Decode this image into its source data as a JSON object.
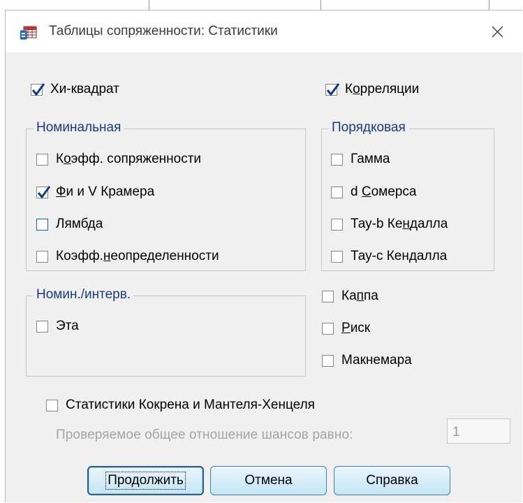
{
  "window": {
    "title": "Таблицы сопряженности: Статистики"
  },
  "top": {
    "chi_square": {
      "label": "Хи-квадрат",
      "checked": true
    },
    "correlations": {
      "label_pre": "К",
      "label_u": "о",
      "label_post": "рреляции",
      "checked": true
    }
  },
  "nominal": {
    "title": "Номинальная",
    "items": [
      {
        "pre": "К",
        "u": "о",
        "post": "эфф. сопряженности",
        "checked": false
      },
      {
        "pre": "",
        "u": "Ф",
        "post": "и и V Крамера",
        "checked": true
      },
      {
        "pre": "",
        "u": "",
        "post": "Лямбда",
        "checked": false
      },
      {
        "pre": "Коэфф.",
        "u": "н",
        "post": "еопределенности",
        "checked": false
      }
    ]
  },
  "ordinal": {
    "title": "Порядковая",
    "items": [
      {
        "pre": "Гамма",
        "u": "",
        "post": "",
        "checked": false
      },
      {
        "pre": "d ",
        "u": "С",
        "post": "омерса",
        "checked": false
      },
      {
        "pre": "Тау-b Ке",
        "u": "н",
        "post": "далла",
        "checked": false
      },
      {
        "pre": "Тау-c Кендалла",
        "u": "",
        "post": "",
        "checked": false
      }
    ]
  },
  "nominal_interval": {
    "title": "Номин./интерв.",
    "items": [
      {
        "label": "Эта",
        "checked": false
      }
    ]
  },
  "misc": {
    "items": [
      {
        "pre": "Ка",
        "u": "п",
        "post": "па",
        "checked": false
      },
      {
        "pre": "",
        "u": "Р",
        "post": "иск",
        "checked": false
      },
      {
        "pre": "Макнемара",
        "u": "",
        "post": "",
        "checked": false
      }
    ]
  },
  "cmh": {
    "label": "Статистики Кокрена и Мантеля-Хенцеля",
    "checked": false,
    "odds_label": "Проверяемое общее отношение шансов равно:",
    "odds_value": "1"
  },
  "buttons": {
    "continue": "Продолжить",
    "cancel": "Отмена",
    "help": "Справка"
  },
  "colors": {
    "group_title": "#1b3a86",
    "check": "#0a3c8c",
    "button_border": "#3c7fb1"
  }
}
